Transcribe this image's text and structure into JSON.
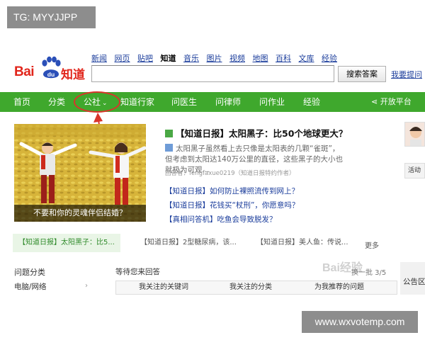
{
  "watermark_top": "TG: MYYJJPP",
  "watermark_bottom": "www.wxvotemp.com",
  "watermark_center": "Bai经验",
  "logo": {
    "bai": "Bai",
    "du": "du",
    "zhidao": "知道"
  },
  "topnav": [
    "新闻",
    "网页",
    "贴吧",
    "知道",
    "音乐",
    "图片",
    "视频",
    "地图",
    "百科",
    "文库",
    "经验"
  ],
  "search": {
    "value": "",
    "button": "搜索答案",
    "ask": "我要提问"
  },
  "greenbar": {
    "items": [
      "首页",
      "分类",
      "公社",
      "知道行家",
      "问医生",
      "问律师",
      "问作业",
      "经验"
    ],
    "open_platform": "开放平台"
  },
  "feature": {
    "photo_caption": "不要和你的灵魂伴侣结婚？",
    "headline": "【知道日报】太阳黑子：比50个地球更大？",
    "summary": "太阳黑子虽然看上去只像是太阳表的几颗“雀斑”，但考虑到太阳达140万公里的直径，这些黑子的大小也就极为可观...",
    "answerer": "回答者：fengfaxue0219（知道日报特约作者）",
    "related": [
      "【知道日报】如何防止裸照流传到网上？",
      "【知道日报】花钱买“杖刑”，你愿意吗？",
      "【真相问答机】吃鱼会导致脱发？"
    ]
  },
  "carousel": [
    "【知道日报】太阳黑子：比5...",
    "【知道日报】2型糖尿病，该...",
    "【知道日报】美人鱼：传说..."
  ],
  "more": "更多",
  "question_category": {
    "title": "问题分类",
    "first": "电脑/网络"
  },
  "waiting": "等待您来回答",
  "pagination": "换一批 3/5",
  "subtabs": [
    "我关注的关键词",
    "我关注的分类",
    "为我推荐的问题"
  ],
  "right": {
    "edge_text": "公告区",
    "button": "活动"
  }
}
